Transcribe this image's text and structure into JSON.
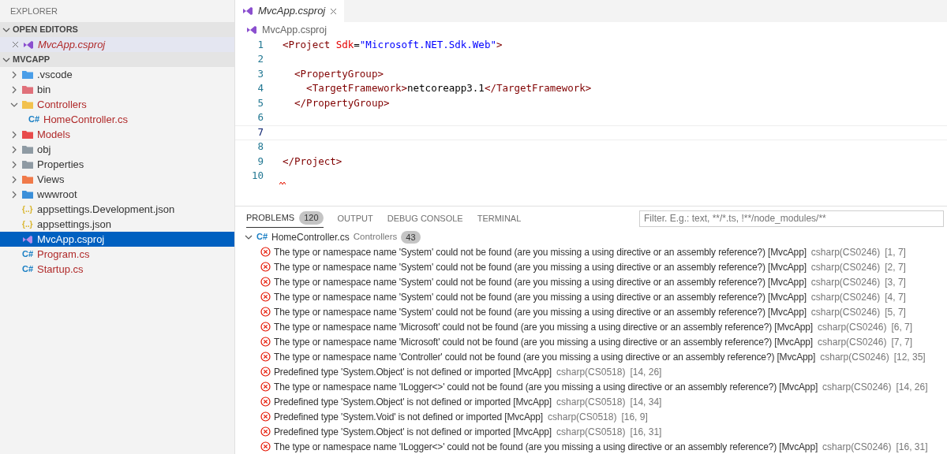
{
  "sidebar": {
    "title": "EXPLORER",
    "open_editors": {
      "title": "OPEN EDITORS",
      "expanded": true,
      "items": [
        {
          "label": "MvcApp.csproj",
          "kind": "csproj",
          "preview": true,
          "error": true,
          "selected": true
        }
      ]
    },
    "project": {
      "title": "MVCAPP",
      "expanded": true,
      "items": [
        {
          "label": ".vscode",
          "kind": "folder",
          "color": "#4a9ee8",
          "expanded": false,
          "error": false,
          "selected": false
        },
        {
          "label": "bin",
          "kind": "folder",
          "color": "#e0707a",
          "expanded": false,
          "error": false,
          "selected": false
        },
        {
          "label": "Controllers",
          "kind": "folder",
          "color": "#f2c14e",
          "expanded": true,
          "error": true,
          "selected": false,
          "children": [
            {
              "label": "HomeController.cs",
              "kind": "csharp",
              "glyph": "C#",
              "error": true,
              "selected": false
            }
          ]
        },
        {
          "label": "Models",
          "kind": "folder",
          "color": "#e84b4b",
          "expanded": false,
          "error": true,
          "selected": false
        },
        {
          "label": "obj",
          "kind": "folder",
          "color": "#8e9aa3",
          "expanded": false,
          "error": false,
          "selected": false
        },
        {
          "label": "Properties",
          "kind": "folder",
          "color": "#8e9aa3",
          "expanded": false,
          "error": false,
          "selected": false
        },
        {
          "label": "Views",
          "kind": "folder",
          "color": "#f07a4a",
          "expanded": false,
          "error": false,
          "selected": false
        },
        {
          "label": "wwwroot",
          "kind": "folder",
          "color": "#3b8fd9",
          "expanded": false,
          "error": false,
          "selected": false
        },
        {
          "label": "appsettings.Development.json",
          "kind": "json",
          "glyph": "{..}",
          "error": false,
          "selected": false
        },
        {
          "label": "appsettings.json",
          "kind": "json",
          "glyph": "{..}",
          "error": false,
          "selected": false
        },
        {
          "label": "MvcApp.csproj",
          "kind": "csproj",
          "error": false,
          "selected": true
        },
        {
          "label": "Program.cs",
          "kind": "csharp",
          "glyph": "C#",
          "error": true,
          "selected": false
        },
        {
          "label": "Startup.cs",
          "kind": "csharp",
          "glyph": "C#",
          "error": true,
          "selected": false
        }
      ]
    }
  },
  "editor": {
    "tabs": [
      {
        "label": "MvcApp.csproj",
        "selected": true,
        "preview": true
      }
    ],
    "breadcrumb": "MvcApp.csproj",
    "lines": [
      {
        "number": "1",
        "current": false,
        "tokens": [
          {
            "kind": "tag",
            "t": "<Project "
          },
          {
            "kind": "attr",
            "t": "Sdk"
          },
          {
            "kind": "text",
            "t": "="
          },
          {
            "kind": "string",
            "t": "\"Microsoft.NET.Sdk.Web\""
          },
          {
            "kind": "tag",
            "t": ">"
          }
        ]
      },
      {
        "number": "2",
        "current": false
      },
      {
        "number": "3",
        "current": false,
        "tokens": [
          {
            "kind": "tag",
            "t": "  <PropertyGroup>"
          }
        ]
      },
      {
        "number": "4",
        "current": false,
        "tokens": [
          {
            "kind": "tag",
            "t": "    <TargetFramework>"
          },
          {
            "kind": "text",
            "t": "netcoreapp3.1"
          },
          {
            "kind": "tag",
            "t": "</TargetFramework>"
          }
        ]
      },
      {
        "number": "5",
        "current": false,
        "tokens": [
          {
            "kind": "tag",
            "t": "  </PropertyGroup>"
          }
        ]
      },
      {
        "number": "6",
        "current": false
      },
      {
        "number": "7",
        "current": true
      },
      {
        "number": "8",
        "current": false
      },
      {
        "number": "9",
        "current": false,
        "tokens": [
          {
            "kind": "tag",
            "t": "</Project>"
          }
        ]
      },
      {
        "number": "10",
        "current": false,
        "squiggle": true
      }
    ]
  },
  "panel": {
    "tabs": [
      {
        "label": "PROBLEMS",
        "count": "120",
        "selected": true
      },
      {
        "label": "OUTPUT",
        "selected": false
      },
      {
        "label": "DEBUG CONSOLE",
        "selected": false
      },
      {
        "label": "TERMINAL",
        "selected": false
      }
    ],
    "filter": {
      "placeholder": "Filter. E.g.: text, **/*.ts, !**/node_modules/**"
    },
    "group": {
      "file": "HomeController.cs",
      "glyph": "C#",
      "folder": "Controllers",
      "count": "43",
      "expanded": true
    },
    "problems": [
      {
        "message": "The type or namespace name 'System' could not be found (are you missing a using directive or an assembly reference?) [MvcApp]",
        "code": "csharp(CS0246)",
        "position": "[1, 7]"
      },
      {
        "message": "The type or namespace name 'System' could not be found (are you missing a using directive or an assembly reference?) [MvcApp]",
        "code": "csharp(CS0246)",
        "position": "[2, 7]"
      },
      {
        "message": "The type or namespace name 'System' could not be found (are you missing a using directive or an assembly reference?) [MvcApp]",
        "code": "csharp(CS0246)",
        "position": "[3, 7]"
      },
      {
        "message": "The type or namespace name 'System' could not be found (are you missing a using directive or an assembly reference?) [MvcApp]",
        "code": "csharp(CS0246)",
        "position": "[4, 7]"
      },
      {
        "message": "The type or namespace name 'System' could not be found (are you missing a using directive or an assembly reference?) [MvcApp]",
        "code": "csharp(CS0246)",
        "position": "[5, 7]"
      },
      {
        "message": "The type or namespace name 'Microsoft' could not be found (are you missing a using directive or an assembly reference?) [MvcApp]",
        "code": "csharp(CS0246)",
        "position": "[6, 7]"
      },
      {
        "message": "The type or namespace name 'Microsoft' could not be found (are you missing a using directive or an assembly reference?) [MvcApp]",
        "code": "csharp(CS0246)",
        "position": "[7, 7]"
      },
      {
        "message": "The type or namespace name 'Controller' could not be found (are you missing a using directive or an assembly reference?) [MvcApp]",
        "code": "csharp(CS0246)",
        "position": "[12, 35]"
      },
      {
        "message": "Predefined type 'System.Object' is not defined or imported [MvcApp]",
        "code": "csharp(CS0518)",
        "position": "[14, 26]"
      },
      {
        "message": "The type or namespace name 'ILogger<>' could not be found (are you missing a using directive or an assembly reference?) [MvcApp]",
        "code": "csharp(CS0246)",
        "position": "[14, 26]"
      },
      {
        "message": "Predefined type 'System.Object' is not defined or imported [MvcApp]",
        "code": "csharp(CS0518)",
        "position": "[14, 34]"
      },
      {
        "message": "Predefined type 'System.Void' is not defined or imported [MvcApp]",
        "code": "csharp(CS0518)",
        "position": "[16, 9]"
      },
      {
        "message": "Predefined type 'System.Object' is not defined or imported [MvcApp]",
        "code": "csharp(CS0518)",
        "position": "[16, 31]"
      },
      {
        "message": "The type or namespace name 'ILogger<>' could not be found (are you missing a using directive or an assembly reference?) [MvcApp]",
        "code": "csharp(CS0246)",
        "position": "[16, 31]"
      }
    ]
  }
}
